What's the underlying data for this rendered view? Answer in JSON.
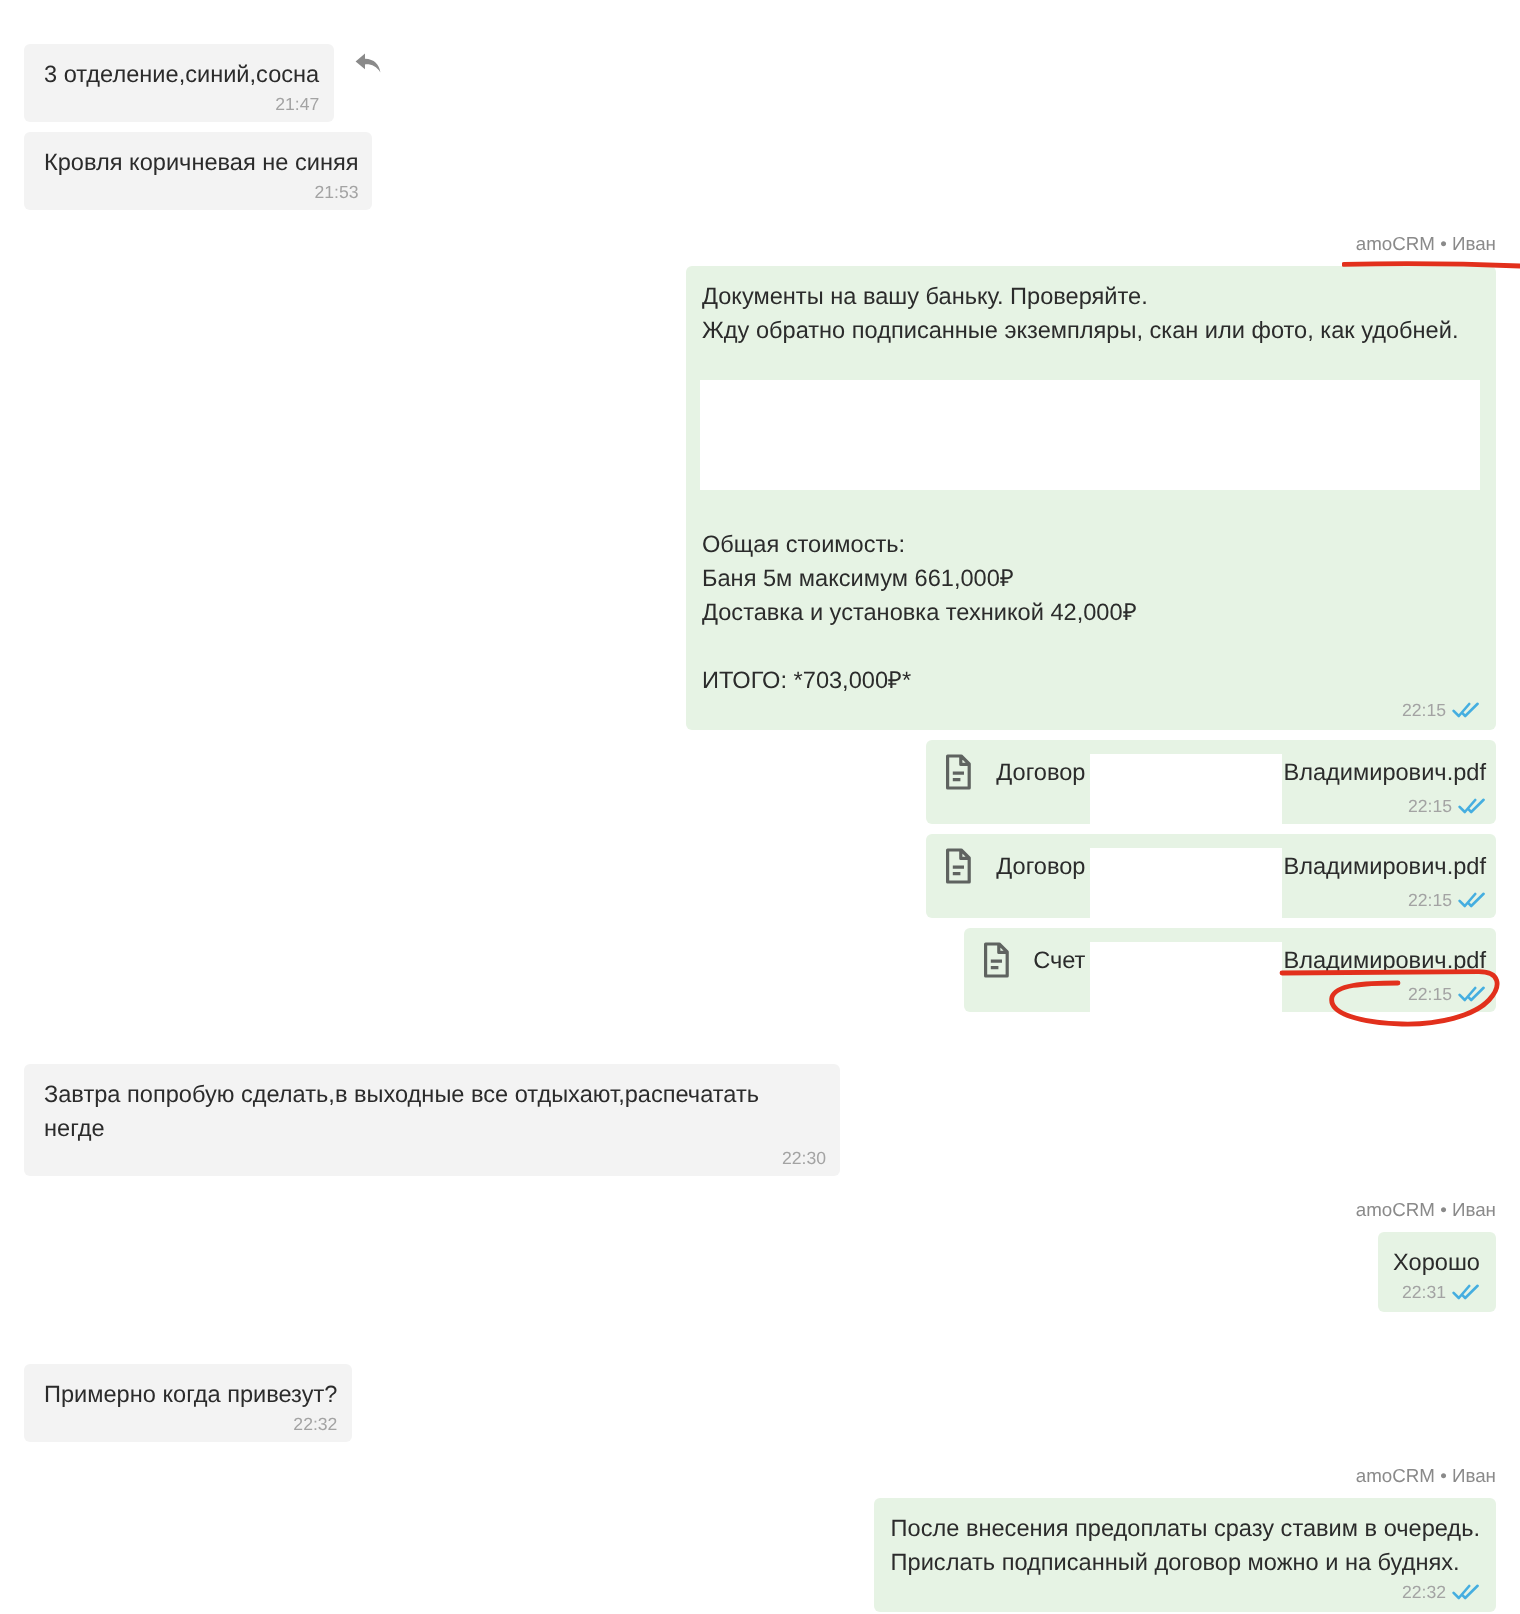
{
  "messages": [
    {
      "kind": "incoming",
      "text": "3 отделение,синий,сосна",
      "time": "21:47",
      "hovered": true
    },
    {
      "kind": "incoming",
      "text": "Кровля коричневая не синяя",
      "time": "21:53",
      "hovered": false
    },
    {
      "kind": "outgoing",
      "sender": "amoCRM • Иван",
      "blocks": [
        {
          "kind": "text",
          "text": "Документы на вашу баньку. Проверяйте.\nЖду обратно подписанные экземпляры, скан или фото, как удобней."
        },
        {
          "kind": "redacted"
        },
        {
          "kind": "text",
          "text": "Общая стоимость:\nБаня 5м максимум 661,000₽\nДоставка и установка техникой 42,000₽\n\nИТОГО: *703,000₽*"
        }
      ],
      "time": "22:15",
      "read": true,
      "hovered": false,
      "underlined": true
    },
    {
      "kind": "file",
      "name_parts": [
        "Договор",
        "Владимирович.pdf"
      ],
      "time": "22:15",
      "read": true,
      "hovered": false
    },
    {
      "kind": "file",
      "name_parts": [
        "Договор",
        "Владимирович.pdf"
      ],
      "time": "22:15",
      "read": true,
      "hovered": false
    },
    {
      "kind": "file",
      "name_parts": [
        "Счет",
        "Владимирович.pdf"
      ],
      "time": "22:15",
      "read": true,
      "hovered": false,
      "circled": true
    },
    {
      "kind": "incoming",
      "text": "Завтра попробую сделать,в выходные все отдыхают,распечатать негде",
      "time": "22:30",
      "hovered": false
    },
    {
      "kind": "outgoing",
      "sender": "amoCRM • Иван",
      "blocks": [
        {
          "kind": "text",
          "text": "Хорошо"
        }
      ],
      "time": "22:31",
      "read": true,
      "hovered": false
    },
    {
      "kind": "incoming",
      "text": "Примерно когда привезут?",
      "time": "22:32",
      "hovered": false
    },
    {
      "kind": "outgoing",
      "sender": "amoCRM • Иван",
      "blocks": [
        {
          "kind": "text",
          "text": "После внесения предоплаты сразу ставим в очередь.\nПрислать подписанный договор можно и на буднях."
        }
      ],
      "time": "22:32",
      "read": true,
      "hovered": false
    }
  ]
}
